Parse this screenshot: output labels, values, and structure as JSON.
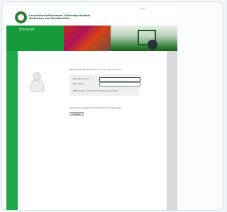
{
  "header": {
    "top_link": "Login",
    "logo_line1": "Landwirtschaftskammer Schleswig-Holstein",
    "logo_line2": "Gartenbau und Forstbetriebe",
    "brand_title": "Extranet"
  },
  "login": {
    "intro": "Bitte geben Sie Benutzername und Kennwort ein.",
    "username_label": "Benutzername:",
    "username_value": "",
    "password_label": "Kennwort:",
    "password_value": "",
    "hint": "Bitte Groß- und Kleinschreibung beachten.",
    "forgot": "Kennwort vergessen? Benutzerkonto beantragen",
    "submit_label": "Anmelden"
  },
  "colors": {
    "brand_green": "#169b3a",
    "rail_green": "#1fa84a",
    "header_green": "#2e7d32",
    "rail_grey": "#d9d9dd"
  },
  "icons": {
    "logo": "organization-logo-icon",
    "user": "user-silhouette-icon"
  }
}
